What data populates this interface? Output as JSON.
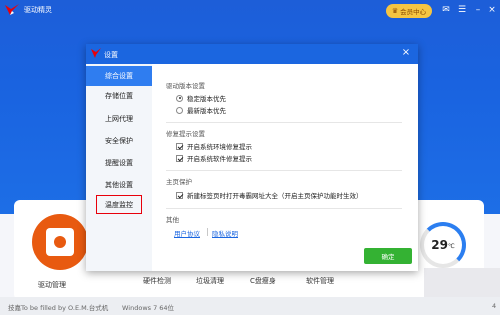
{
  "app": {
    "title": "驱动精灵",
    "vip_label": "会员中心",
    "colors": {
      "brand": "#1b66e0",
      "vip": "#f5c542",
      "accent_red": "#e8000b",
      "confirm": "#34b233"
    }
  },
  "features": {
    "driver_mgmt": "驱动管理",
    "hardware": "硬件检测",
    "cleanup": "垃圾清理",
    "disk": "C盘瘦身",
    "software": "软件管理"
  },
  "temperature": {
    "value": "29",
    "unit": "℃"
  },
  "status_bar": {
    "machine": "技嘉To be filled by O.E.M.台式机",
    "os": "Windows 7 64位",
    "right_digit": "4"
  },
  "dialog": {
    "title": "设置",
    "sidebar": [
      {
        "label": "综合设置"
      },
      {
        "label": "存储位置"
      },
      {
        "label": "上网代理"
      },
      {
        "label": "安全保护"
      },
      {
        "label": "提醒设置"
      },
      {
        "label": "其他设置"
      },
      {
        "label": "温度监控"
      }
    ],
    "sections": {
      "driver_version": {
        "title": "驱动版本设置",
        "options": [
          "稳定版本优先",
          "最新版本优先"
        ],
        "selected": 0
      },
      "repair": {
        "title": "修复提示设置",
        "options": [
          "开启系统环境修复提示",
          "开启系统软件修复提示"
        ]
      },
      "homepage": {
        "title": "主页保护",
        "option": "新建标签页时打开毒霸网址大全（开启主页保护功能时生效）"
      },
      "other": {
        "title": "其他",
        "links": [
          "用户协议",
          "隐私说明"
        ]
      }
    },
    "confirm_label": "确定"
  }
}
